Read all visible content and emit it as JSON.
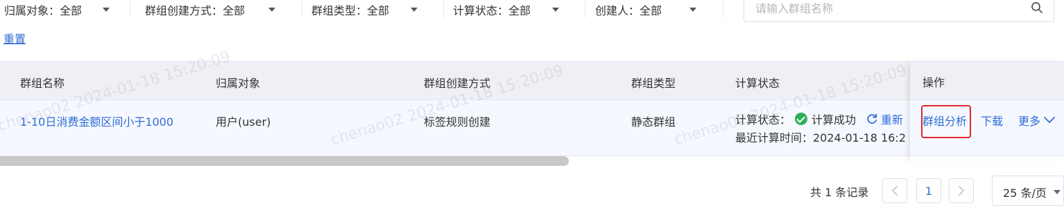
{
  "filters": {
    "owner": "归属对象：全部",
    "create_method": "群组创建方式：全部",
    "group_type": "群组类型：全部",
    "calc_status": "计算状态：全部",
    "creator": "创建人：全部"
  },
  "search": {
    "placeholder": "请输入群组名称",
    "value": ""
  },
  "reset_label": "重置",
  "table": {
    "headers": {
      "name": "群组名称",
      "owner": "归属对象",
      "method": "群组创建方式",
      "type": "群组类型",
      "status": "计算状态",
      "ops": "操作"
    },
    "rows": [
      {
        "name": "1-10日消费金额区间小于1000",
        "owner": "用户(user)",
        "method": "标签规则创建",
        "type": "静态群组",
        "status_label": "计算状态：",
        "status_value": "计算成功",
        "refresh_label": "重新",
        "last_calc": "最近计算时间：2024-01-18 16:2",
        "ops": {
          "analyze": "群组分析",
          "download": "下载",
          "more": "更多"
        }
      }
    ]
  },
  "watermark": "chenao02 2024-01-18 15:20:09",
  "pagination": {
    "total": "共 1 条记录",
    "current_page": "1",
    "page_size": "25 条/页"
  },
  "colors": {
    "link": "#2e6cd6",
    "success": "#2fae5a",
    "highlight": "#e0262c",
    "header_bg": "#eef0f5",
    "row_bg": "#f5f8ff"
  }
}
